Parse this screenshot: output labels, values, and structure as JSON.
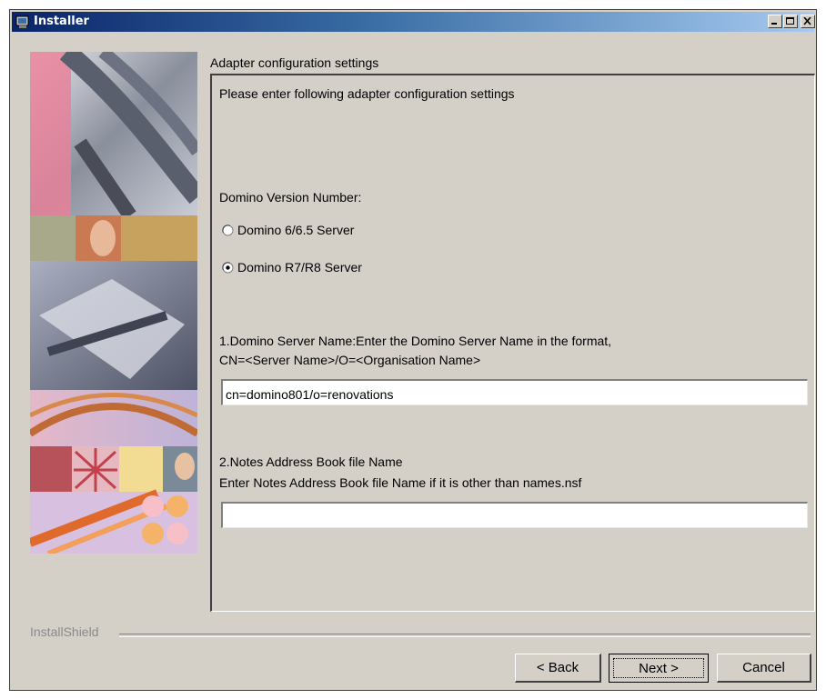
{
  "window": {
    "title": "Installer",
    "controls": [
      "minimize",
      "maximize",
      "close"
    ]
  },
  "panel": {
    "title": "Adapter configuration settings",
    "intro": "Please enter following adapter configuration settings",
    "version_label": "Domino Version Number:",
    "options": [
      {
        "label": "Domino 6/6.5 Server",
        "selected": false
      },
      {
        "label": "Domino R7/R8 Server",
        "selected": true
      }
    ],
    "server_name": {
      "label_line1": "1.Domino Server Name:Enter the Domino Server Name in the format,",
      "label_line2": "CN=<Server Name>/O=<Organisation Name>",
      "value": "cn=domino801/o=renovations"
    },
    "address_book": {
      "label_line1": "2.Notes Address Book file Name",
      "label_line2": "Enter Notes Address Book file Name if it is other than names.nsf",
      "value": ""
    }
  },
  "footer": {
    "branding": "InstallShield",
    "back": "< Back",
    "next": "Next >",
    "cancel": "Cancel"
  },
  "colors": {
    "titlebar_start": "#0a246a",
    "titlebar_end": "#a6caf0",
    "dialog_bg": "#d4d0c8"
  }
}
